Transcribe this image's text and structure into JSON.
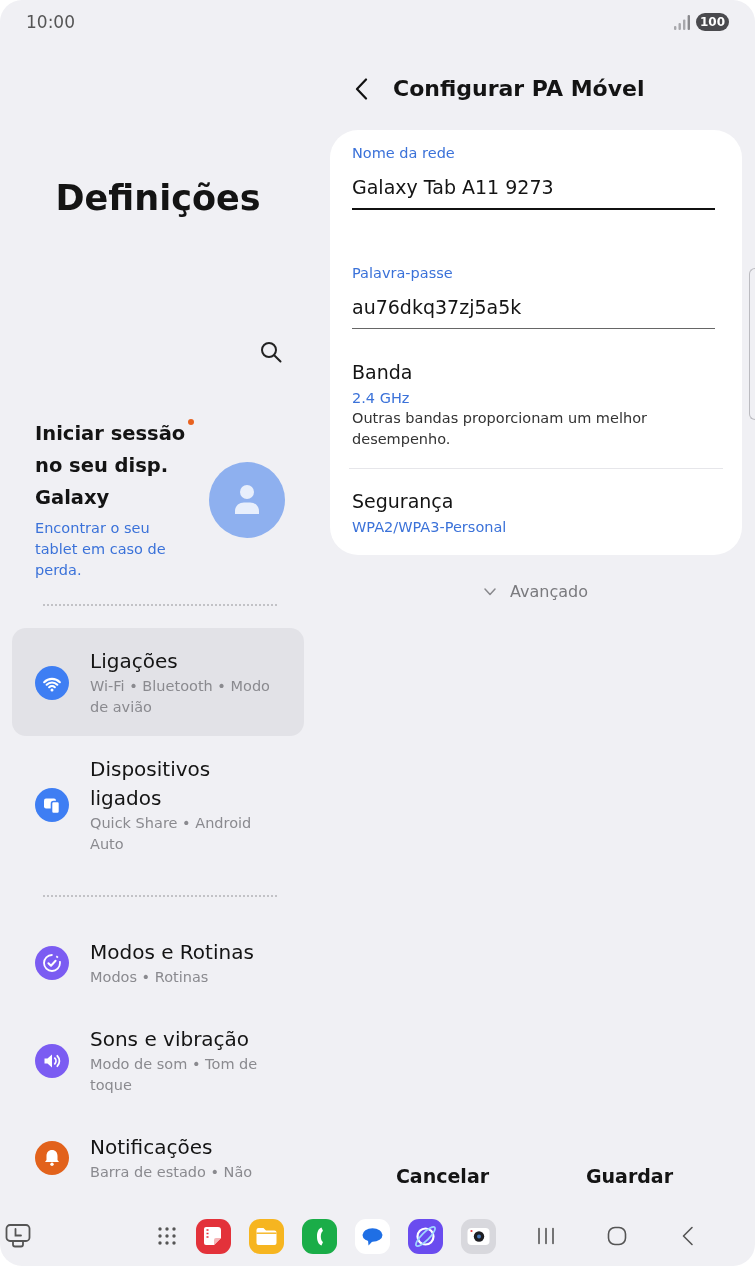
{
  "status_bar": {
    "time": "10:00",
    "battery": "100"
  },
  "sidebar": {
    "title": "Definições",
    "account": {
      "title": "Iniciar sessão no seu disp. Galaxy",
      "subtitle": "Encontrar o seu tablet em caso de perda.",
      "notification_dot": true
    },
    "groups": [
      {
        "items": [
          {
            "title": "Ligações",
            "subtitle": "Wi-Fi • Bluetooth • Modo de avião",
            "color": "#3e7ef3",
            "selected": true
          },
          {
            "title": "Dispositivos ligados",
            "subtitle": "Quick Share • Android Auto",
            "color": "#3e7ef3",
            "selected": false
          }
        ]
      },
      {
        "items": [
          {
            "title": "Modos e Rotinas",
            "subtitle": "Modos • Rotinas",
            "color": "#7b5cf2",
            "selected": false
          },
          {
            "title": "Sons e vibração",
            "subtitle": "Modo de som • Tom de toque",
            "color": "#7b5cf2",
            "selected": false
          },
          {
            "title": "Notificações",
            "subtitle": "Barra de estado • Não",
            "color": "#e2621b",
            "selected": false
          }
        ]
      }
    ]
  },
  "header": {
    "title": "Configurar PA Móvel"
  },
  "form": {
    "fields": [
      {
        "label": "Nome da rede",
        "value": "Galaxy Tab A11 9273",
        "focused": true
      },
      {
        "label": "Palavra-passe",
        "value": "au76dkq37zj5a5k",
        "focused": false
      }
    ],
    "settings": [
      {
        "title": "Banda",
        "value": "2.4 GHz",
        "note": "Outras bandas proporcionam um melhor desempenho."
      },
      {
        "title": "Segurança",
        "value": "WPA2/WPA3-Personal"
      }
    ]
  },
  "advanced": {
    "label": "Avançado",
    "expanded": false
  },
  "buttons": [
    {
      "label": "Cancelar"
    },
    {
      "label": "Guardar"
    }
  ]
}
